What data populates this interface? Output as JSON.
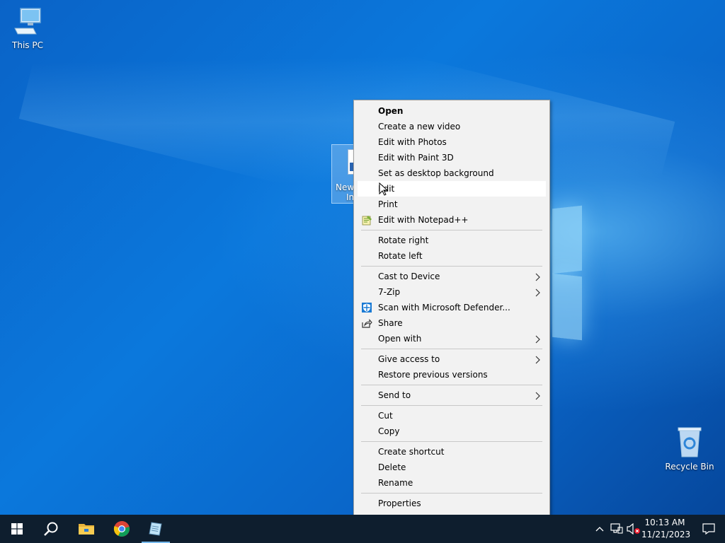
{
  "desktop": {
    "icons": {
      "this_pc": "This PC",
      "recycle_bin": "Recycle Bin",
      "selected_file_line1": "New",
      "selected_file_line2": "In"
    }
  },
  "context_menu": {
    "items": [
      {
        "label": "Open",
        "bold": true
      },
      {
        "label": "Create a new video"
      },
      {
        "label": "Edit with Photos"
      },
      {
        "label": "Edit with Paint 3D"
      },
      {
        "label": "Set as desktop background"
      },
      {
        "label": "Edit",
        "hovered": true
      },
      {
        "label": "Print"
      },
      {
        "label": "Edit with Notepad++",
        "icon": "notepadpp-icon"
      },
      {
        "label": "Rotate right"
      },
      {
        "label": "Rotate left"
      },
      {
        "label": "Cast to Device",
        "submenu": true
      },
      {
        "label": "7-Zip",
        "submenu": true
      },
      {
        "label": "Scan with Microsoft Defender...",
        "icon": "defender-shield-icon"
      },
      {
        "label": "Share",
        "icon": "share-icon"
      },
      {
        "label": "Open with",
        "submenu": true
      },
      {
        "label": "Give access to",
        "submenu": true
      },
      {
        "label": "Restore previous versions"
      },
      {
        "label": "Send to",
        "submenu": true
      },
      {
        "label": "Cut"
      },
      {
        "label": "Copy"
      },
      {
        "label": "Create shortcut"
      },
      {
        "label": "Delete"
      },
      {
        "label": "Rename"
      },
      {
        "label": "Properties"
      }
    ]
  },
  "taskbar": {
    "apps": [
      "start-icon",
      "search-icon",
      "file-explorer-icon",
      "chrome-icon",
      "notepad-icon"
    ],
    "tray": {
      "time": "10:13 AM",
      "date": "11/21/2023",
      "icons": [
        "chevron-up-icon",
        "network-icon",
        "volume-muted-icon",
        "notification-icon"
      ]
    }
  },
  "colors": {
    "taskbar": "#0e1e2e",
    "menu_bg": "#f2f2f2",
    "menu_hover": "#ffffff",
    "desktop_blue": "#0a6fd6"
  }
}
